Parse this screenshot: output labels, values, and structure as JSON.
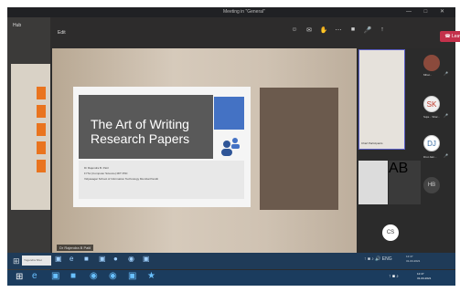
{
  "window": {
    "title": "Meeting in \"General\"",
    "controls": "— □ ✕"
  },
  "left_panel": {
    "title": "Hub",
    "icon": "☺"
  },
  "teams_bar": {
    "edit_label": "Edit",
    "timer": "",
    "icons": [
      "☺",
      "✉",
      "✋",
      "⋯",
      "■",
      "🎤",
      "↑"
    ],
    "leave_label": "☎ Leave"
  },
  "slide": {
    "title": "The Art of Writing Research Papers",
    "footer_line1": "Dr Rajendra B. Patil",
    "footer_line2": "FYSc (Computer Science) MIT PhD",
    "footer_line3": "Vidyasagar School of Information Technology Mumbai Pandit"
  },
  "presenter_label": "Dr Rajendra B Patil",
  "participants": {
    "main_tile_label": "Chief Participants",
    "small_tile_label": "Dr Yogendra Shet",
    "other_tile_label": "AB",
    "cs_initials": "CS",
    "people": [
      {
        "initials": "",
        "name": "Mhat..."
      },
      {
        "initials": "SK",
        "name": "Suja... Shar..."
      },
      {
        "initials": "DJ",
        "name": "Drut Jain..."
      },
      {
        "initials": "HB",
        "name": ""
      }
    ]
  },
  "inner_taskbar": {
    "search": "Yogendra Shet",
    "start_icon": "⊞",
    "apps": [
      "▣",
      "e",
      "■",
      "▣",
      "●",
      "◉",
      "▣"
    ],
    "tray": "↑ ■ ♪ 🔊 ENG",
    "clock_time": "12:47",
    "clock_date": "31-03-2021"
  },
  "outer_taskbar": {
    "start_icon": "⊞",
    "apps": [
      "e",
      "▣",
      "■",
      "◉",
      "◉",
      "▣",
      "★"
    ],
    "tray": "↑ ■ ♪",
    "clock_time": "12:47",
    "clock_date": "31-03-2021"
  }
}
